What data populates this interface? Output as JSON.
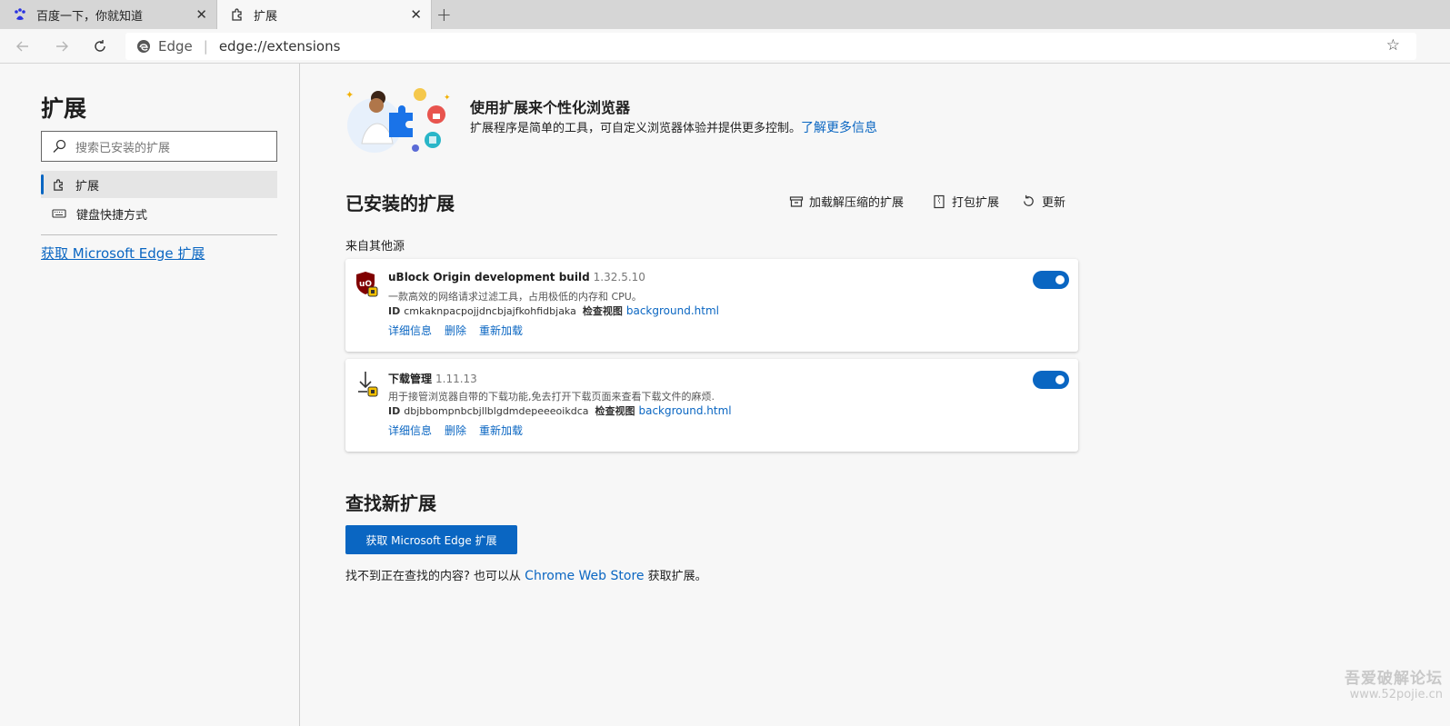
{
  "tabs": [
    {
      "title": "百度一下，你就知道",
      "icon": "baidu-paw-icon",
      "close": "✕"
    },
    {
      "title": "扩展",
      "icon": "puzzle-icon",
      "close": "✕",
      "active": true
    }
  ],
  "new_tab": "+",
  "address": {
    "site_label": "Edge",
    "separator": "|",
    "url": "edge://extensions"
  },
  "sidebar": {
    "title": "扩展",
    "search_placeholder": "搜索已安装的扩展",
    "items": [
      {
        "label": "扩展",
        "icon": "puzzle-icon",
        "selected": true
      },
      {
        "label": "键盘快捷方式",
        "icon": "keyboard-icon"
      }
    ],
    "get_link": "获取 Microsoft Edge 扩展"
  },
  "hero": {
    "title": "使用扩展来个性化浏览器",
    "desc": "扩展程序是简单的工具，可自定义浏览器体验并提供更多控制。",
    "learn_more": "了解更多信息"
  },
  "installed": {
    "title": "已安装的扩展",
    "actions": {
      "load": "加载解压缩的扩展",
      "pack": "打包扩展",
      "update": "更新"
    },
    "source_title": "来自其他源",
    "extensions": [
      {
        "name": "uBlock Origin development build",
        "version": "1.32.5.10",
        "desc": "一款高效的网络请求过滤工具，占用极低的内存和 CPU。",
        "id_label": "ID",
        "id": "cmkaknpacpojjdncbjajfkohfidbjaka",
        "inspect_label": "检查视图",
        "inspect_link": "background.html",
        "links": [
          "详细信息",
          "删除",
          "重新加载"
        ],
        "enabled": true,
        "icon": "ublock-shield-icon"
      },
      {
        "name": "下载管理",
        "version": "1.11.13",
        "desc": "用于接管浏览器自带的下载功能,免去打开下载页面来查看下载文件的麻烦.",
        "id_label": "ID",
        "id": "dbjbbompnbcbjllblgdmdepeeeoikdca",
        "inspect_label": "检查视图",
        "inspect_link": "background.html",
        "links": [
          "详细信息",
          "删除",
          "重新加载"
        ],
        "enabled": true,
        "icon": "download-arrow-icon"
      }
    ]
  },
  "find": {
    "title": "查找新扩展",
    "button": "获取 Microsoft Edge 扩展",
    "desc_pre": "找不到正在查找的内容? 也可以从 ",
    "link": "Chrome Web Store",
    "desc_post": " 获取扩展。"
  },
  "watermark": {
    "line1": "吾爱破解论坛",
    "line2": "www.52pojie.cn"
  },
  "colors": {
    "accent": "#0a66c2",
    "tabbar": "#d6d6d6",
    "page_bg": "#f7f7f7"
  }
}
